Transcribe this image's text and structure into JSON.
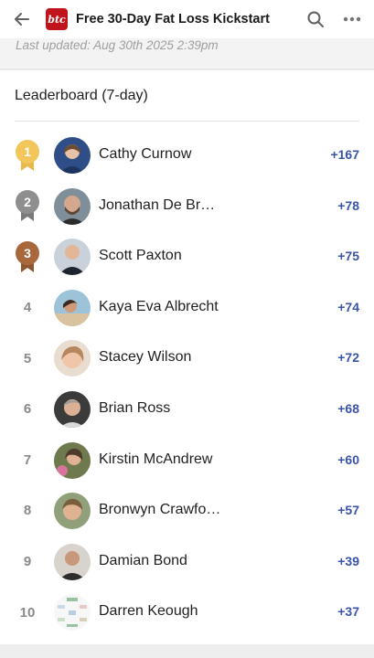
{
  "header": {
    "back_icon": "arrow-left-icon",
    "logo_text": "btc",
    "title": "Free 30-Day Fat Loss Kickstart",
    "search_icon": "search-icon",
    "more_icon": "more-horizontal-icon"
  },
  "last_updated": "Last updated: Aug 30th 2025 2:39pm",
  "leaderboard": {
    "title": "Leaderboard (7-day)",
    "entries": [
      {
        "rank": "1",
        "name": "Cathy Curnow",
        "points": "+167",
        "badge": "gold-medal-icon"
      },
      {
        "rank": "2",
        "name": "Jonathan De Br…",
        "points": "+78",
        "badge": "silver-medal-icon"
      },
      {
        "rank": "3",
        "name": "Scott Paxton",
        "points": "+75",
        "badge": "bronze-medal-icon"
      },
      {
        "rank": "4",
        "name": "Kaya Eva Albrecht",
        "points": "+74"
      },
      {
        "rank": "5",
        "name": "Stacey Wilson",
        "points": "+72"
      },
      {
        "rank": "6",
        "name": "Brian Ross",
        "points": "+68"
      },
      {
        "rank": "7",
        "name": "Kirstin McAndrew",
        "points": "+60"
      },
      {
        "rank": "8",
        "name": "Bronwyn Crawfo…",
        "points": "+57"
      },
      {
        "rank": "9",
        "name": "Damian Bond",
        "points": "+39"
      },
      {
        "rank": "10",
        "name": "Darren Keough",
        "points": "+37"
      }
    ]
  },
  "colors": {
    "accent": "#3a54a8",
    "gold": "#f2c65a",
    "silver": "#8e8e8e",
    "bronze": "#a8683c",
    "logo": "#c0141c"
  }
}
